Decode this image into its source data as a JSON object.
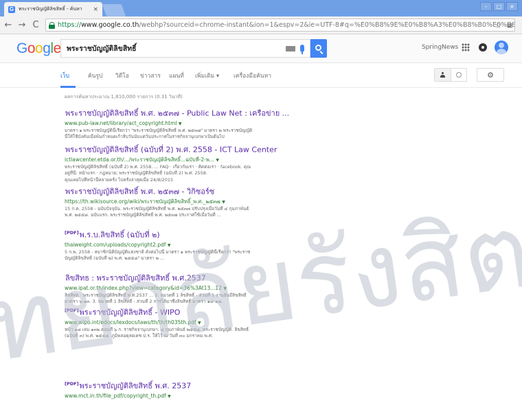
{
  "browser": {
    "tab_title": "พระราชบัญญัติลิขสิทธิ์ - ค้นหา",
    "tab_close": "×",
    "url_scheme": "https://",
    "url_host": "www.google.co.th",
    "url_path": "/webhp?sourceid=chrome-instant&ion=1&espv=2&ie=UTF-8#q=%E0%B8%9E%E0%B8%A3%E0%B8%B0%E0%B8%A3%E0%B8%B2%E0",
    "back": "←",
    "forward": "→",
    "reload": "C",
    "star": "☆",
    "menu": "≡",
    "window_buttons": [
      "–",
      "□",
      "×"
    ]
  },
  "google": {
    "logo_letters": [
      "G",
      "o",
      "o",
      "g",
      "l",
      "e"
    ],
    "query": "พระราชบัญญัติลิขสิทธิ์",
    "user_name": "SpringNews",
    "colors": {
      "brand_blue": "#4285f4",
      "link_visited": "#5b2aa8",
      "url_green": "#2e7d32",
      "highlight_red": "#d23f31"
    }
  },
  "tabs": {
    "items": [
      "เว็บ",
      "ค้นรูป",
      "วิดีโอ",
      "ข่าวสาร",
      "แผนที่",
      "เพิ่มเติม ▾",
      "เครื่องมือค้นหา"
    ],
    "active_index": 0,
    "settings_icon": "⚙"
  },
  "stats": "ผลการค้นหาประมาณ 1,810,000 รายการ (0.31 วินาที)",
  "results": [
    {
      "title": "พระราชบัญญัติลิขสิทธิ์ พ.ศ. ๒๕๓๗ - Public Law Net : เครือข่าย ...",
      "pdf": "",
      "url": "www.pub-law.net/library/act_copyright.html",
      "snippet": [
        "มาตรา ๑ พระราชบัญญัตินี้เรียกว่า \"พระราชบัญญัติลิขสิทธิ์ พ.ศ. ๒๕๓๗\" มาตรา ๒ พระราชบัญญัติ",
        "นี้ให้ใช้บังคับเมื่อพ้นกำหนดเก้าสิบวันนับแต่วันประกาศในราชกิจจานุเบกษาเป็นต้นไป"
      ]
    },
    {
      "title": "พระราชบัญญัติลิขสิทธิ์ (ฉบับที่ 2) พ.ศ. 2558 - ICT Law Center",
      "pdf": "",
      "url": "ictlawcenter.etda.or.th/.../พระราชบัญญัติลิขสิทธิ์...ฉบับที่-2-พ...",
      "snippet": [
        "พระราชบัญญัติลิขสิทธิ์ (ฉบับที่ 2) พ.ศ. 2558. ... FAQ · เกี่ยวกับเรา · ติดต่อเรา · facebook. คุณ",
        "อยู่ที่นี่: หน้าแรก · กฎหมาย; พระราชบัญญัติลิขสิทธิ์ (ฉบับที่ 2) พ.ศ. 2558.",
        "คุณเคยไปที่หน้านี้หลายครั้ง ไปครั้งล่าสุดเมื่อ 24/8/2015"
      ]
    },
    {
      "title": "พระราชบัญญัติลิขสิทธิ์ พ.ศ. ๒๕๓๗ - วิกิซอร์ซ",
      "pdf": "",
      "url": "https://th.wikisource.org/wiki/พระราชบัญญัติลิขสิทธิ์_พ.ศ._๒๕๓๗",
      "snippet": [
        "15 ก.ค. 2558 - ฉบับปัจจุบัน. พระราชบัญญัติลิขสิทธิ์ พ.ศ. ๒๕๓๗ ปรับปรุงเมื่อวันที่ ๔ กุมภาพันธ์",
        "พ.ศ. ๒๕๕๘. ฉบับแรก. พระราชบัญญัติลิขสิทธิ์ พ.ศ. ๒๕๓๗ ประกาศใช้เมื่อวันที่ ..."
      ]
    },
    {
      "title": "พ.ร.บ.ลิขสิทธิ์ (ฉบับที่ ๒)",
      "pdf": "[PDF]",
      "url": "thaiweight.com/uploads/copyright2.pdf",
      "snippet": [
        "5 ก.พ. 2558 - สมาชิกนิติบัญญัติแห่งชาติ ดังต่อไปนี้ มาตรา ๑ พระราชบัญญัตินี้เรียกว่า \"พระราช",
        "บัญญัติลิขสิทธิ์ (ฉบับที่ ๒) พ.ศ. ๒๕๕๘\" มาตรา ๒ ..."
      ]
    },
    {
      "title": "ลิขสิทธ : พระราชบัญญัติลิขสิทธิ์ พ.ศ.2537",
      "pdf": "",
      "url": "www.ipat.or.th/index.php?view=category&id=36%3At13...12",
      "snippet": [
        "ลิขสิทธ · พระราชบัญญัติลิขสิทธิ์ พ.ศ.2537 ... 2. หมวดที่ 1 ลิขสิทธิ์ - ส่วนที่ 1 งานอันมีลิขสิทธิ์",
        "มาตรา ๖-๑๓. 3. หมวดที่ 1 ลิขสิทธิ์ - ส่วนที่ 2 การได้มาซึ่งลิขสิทธิ์ มาตรา ๑๔-๑๘."
      ]
    },
    {
      "title": "พระราชบัญญัติลิขสิทธิ์ - WIPO",
      "pdf": "[PDF]",
      "url": "www.wipo.int/edocs/lexdocs/laws/th/th/th035th.pdf",
      "snippet": [
        "หน้า ๑๘ เล่ม ๑๓๒ ตอนที่ ๖ ก. ราชกิจจานุเบกษา. ๔ กุมภาพันธ์ ๒๕๕๘. พระราชบัญญัติ. ลิขสิทธิ์",
        "(ฉบับที่ ๓) พ.ศ. ๒๕๕๘. ภูมิพลอดุลยเดช ป.ร. ให้ไว้ ณ วันที่ ๓๐ มกราคม พ.ศ."
      ]
    },
    {
      "title": "พระราชบัญญัติลิขสิทธิ์ พ.ศ. 2537",
      "pdf": "[PDF]",
      "url": "www.mct.in.th/file_pdf/copyright_th.pdf",
      "snippet": []
    }
  ],
  "watermark": {
    "text": "ทยาลัยรังสิต",
    "color": "#bcc1cc"
  }
}
